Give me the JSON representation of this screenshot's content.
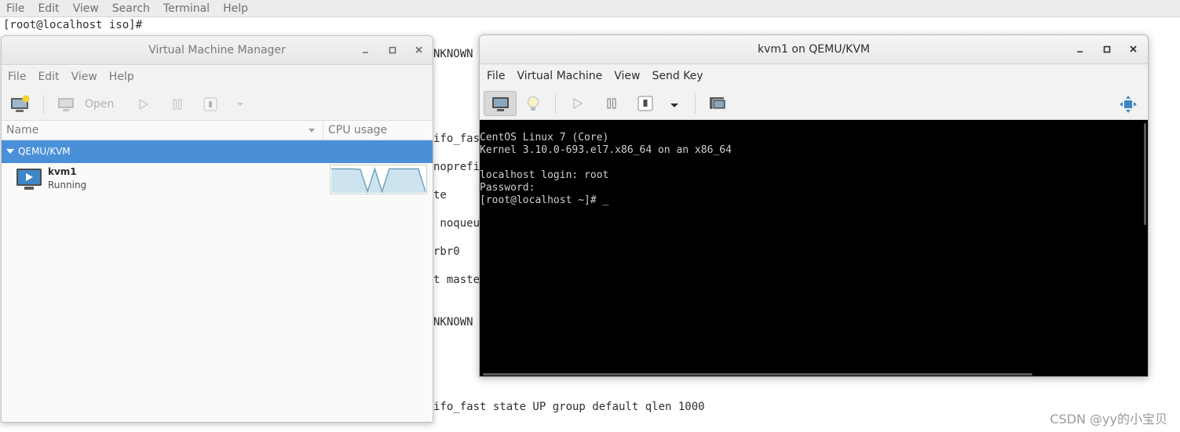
{
  "background_terminal": {
    "menu": [
      "File",
      "Edit",
      "View",
      "Search",
      "Terminal",
      "Help"
    ],
    "prompt": "[root@localhost iso]#",
    "partial_lines": [
      "NKNOWN",
      "ifo_fas",
      "noprefi",
      "te",
      " noqueu",
      "rbr0",
      "t maste",
      "NKNOWN",
      "ifo_fast state UP group default qlen 1000"
    ]
  },
  "vmm": {
    "title": "Virtual Machine Manager",
    "menu": [
      "File",
      "Edit",
      "View",
      "Help"
    ],
    "toolbar": {
      "open_label": "Open"
    },
    "columns": {
      "name": "Name",
      "cpu": "CPU usage"
    },
    "group": "QEMU/KVM",
    "vm": {
      "name": "kvm1",
      "status": "Running"
    },
    "window_controls": {
      "minimize": "–",
      "maximize": "□",
      "close": "✕"
    }
  },
  "kvm": {
    "title": "kvm1 on QEMU/KVM",
    "menu": [
      "File",
      "Virtual Machine",
      "View",
      "Send Key"
    ],
    "console_lines": [
      "CentOS Linux 7 (Core)",
      "Kernel 3.10.0-693.el7.x86_64 on an x86_64",
      "",
      "localhost login: root",
      "Password:",
      "[root@localhost ~]# _"
    ]
  },
  "watermark": "CSDN @yy的小宝贝",
  "colors": {
    "selection": "#4a90d9",
    "console_bg": "#000000",
    "console_text": "#d0d0d0",
    "cpu_graph_fill": "#cde4ef",
    "cpu_graph_line": "#6fa3bf"
  },
  "cpu_usage_series": [
    0.9,
    0.9,
    0.9,
    0.9,
    0.88,
    0.05,
    0.9,
    0.05,
    0.9,
    0.9,
    0.9,
    0.9,
    0.9,
    0.05
  ]
}
